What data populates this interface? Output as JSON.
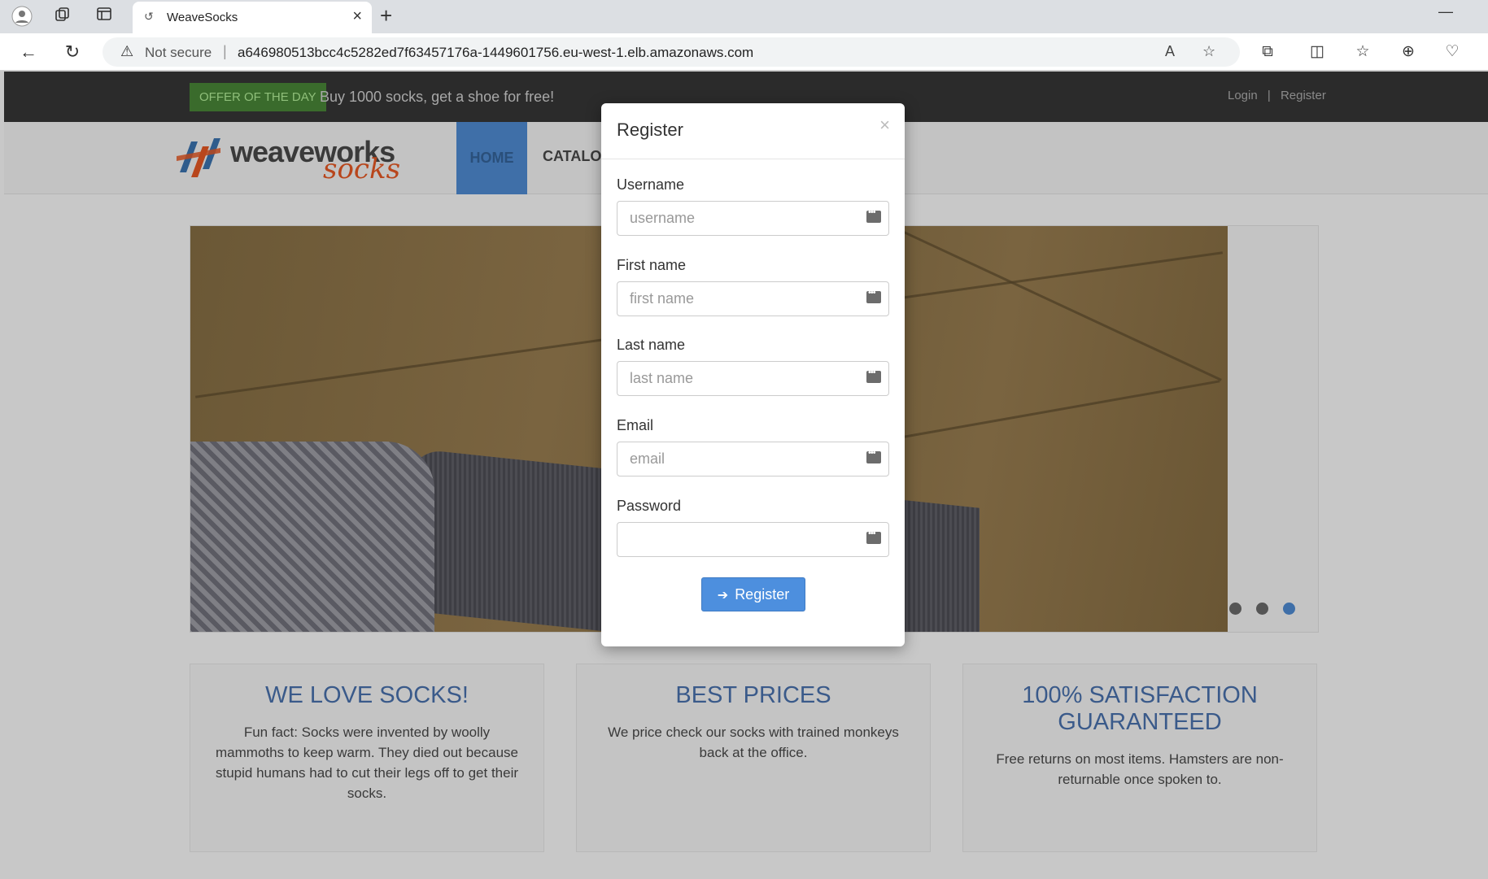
{
  "browser": {
    "tab_title": "WeaveSocks",
    "security_label": "Not secure",
    "url": "a646980513bcc4c5282ed7f63457176a-1449601756.eu-west-1.elb.amazonaws.com"
  },
  "topbar": {
    "offer_badge": "OFFER OF THE DAY",
    "offer_text": "Buy 1000 socks, get a shoe for free!",
    "login": "Login",
    "separator": "|",
    "register": "Register"
  },
  "header": {
    "logo_weave": "weaveworks",
    "logo_socks": "socks",
    "nav_home": "HOME",
    "nav_catalogue": "CATALOG"
  },
  "features": [
    {
      "title": "WE LOVE SOCKS!",
      "text": "Fun fact: Socks were invented by woolly mammoths to keep warm. They died out because stupid humans had to cut their legs off to get their socks."
    },
    {
      "title": "BEST PRICES",
      "text": "We price check our socks with trained monkeys back at the office."
    },
    {
      "title": "100% SATISFACTION GUARANTEED",
      "text": "Free returns on most items. Hamsters are non-returnable once spoken to."
    }
  ],
  "carousel": {
    "slides": 3,
    "active_index": 2,
    "active_color": "#3f6fa8",
    "inactive_color": "#555555"
  },
  "modal": {
    "title": "Register",
    "close": "×",
    "username_label": "Username",
    "username_placeholder": "username",
    "firstname_label": "First name",
    "firstname_placeholder": "first name",
    "lastname_label": "Last name",
    "lastname_placeholder": "last name",
    "email_label": "Email",
    "email_placeholder": "email",
    "password_label": "Password",
    "password_placeholder": "",
    "submit_label": "Register"
  },
  "colors": {
    "accent": "#4d8fde",
    "nav_active": "#3f6fa8",
    "feature_title": "#3a5a8a"
  }
}
